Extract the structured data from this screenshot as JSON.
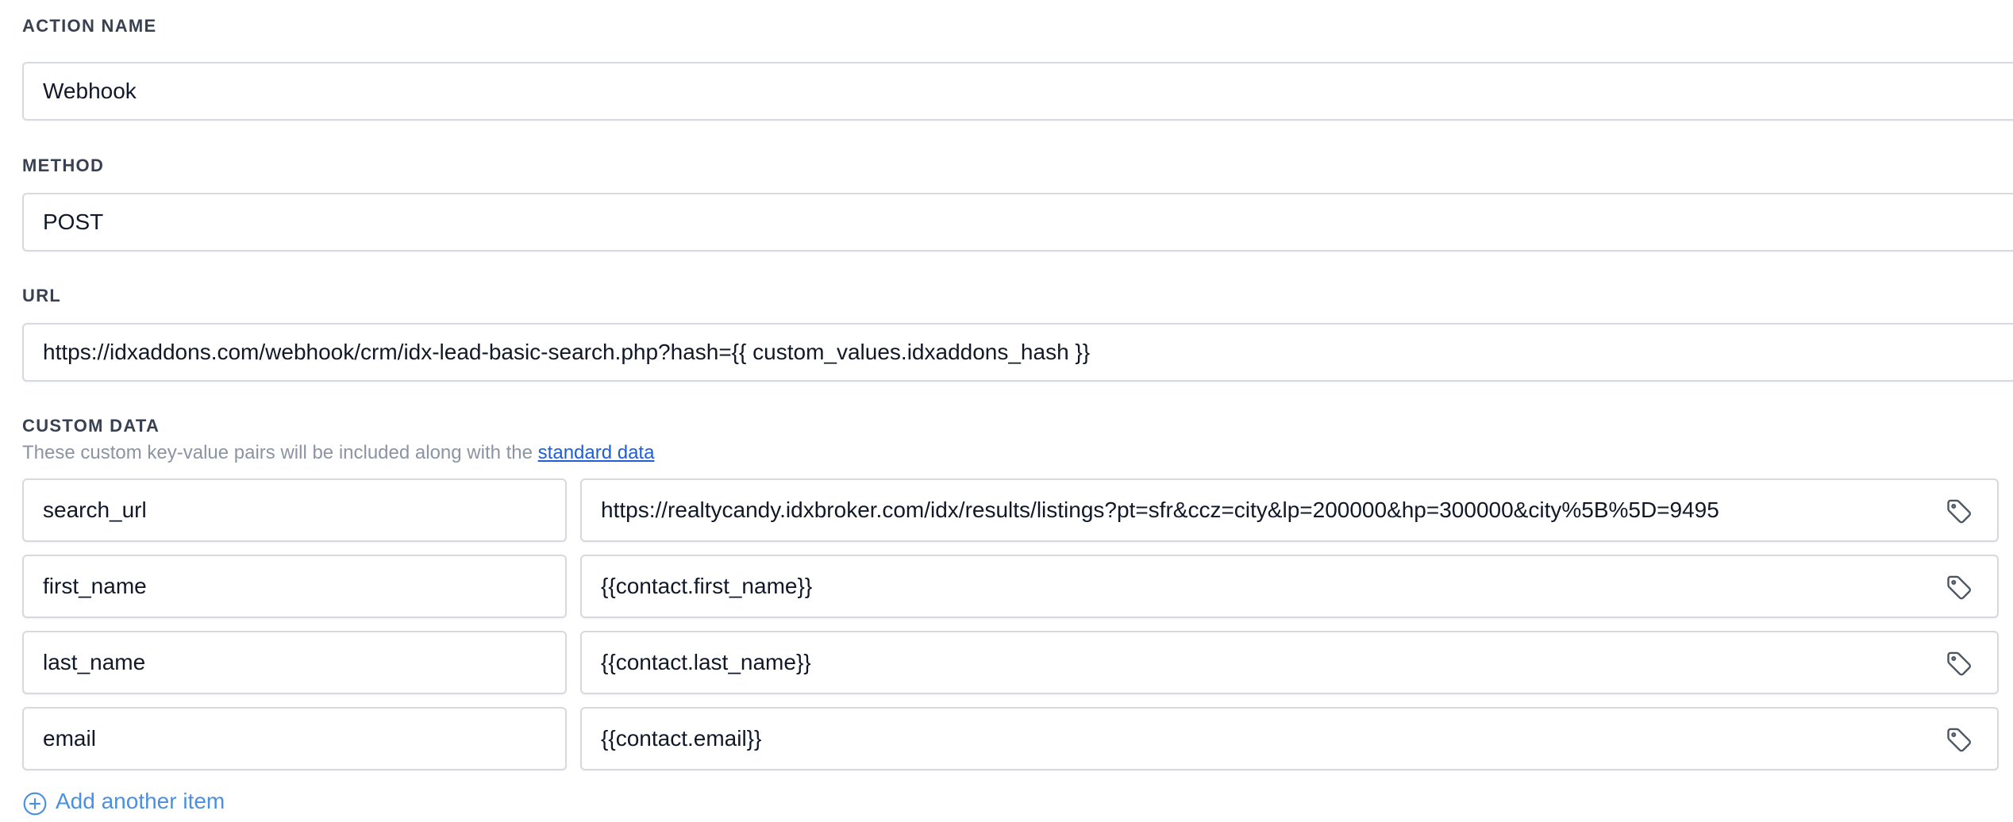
{
  "action_name": {
    "label": "ACTION NAME",
    "value": "Webhook"
  },
  "method": {
    "label": "METHOD",
    "value": "POST"
  },
  "url": {
    "label": "URL",
    "value": "https://idxaddons.com/webhook/crm/idx-lead-basic-search.php?hash={{ custom_values.idxaddons_hash }}"
  },
  "custom_data": {
    "label": "CUSTOM DATA",
    "helper_prefix": "These custom key-value pairs will be included along with the ",
    "helper_link": "standard data",
    "rows": [
      {
        "key": "search_url",
        "value": "https://realtycandy.idxbroker.com/idx/results/listings?pt=sfr&ccz=city&lp=200000&hp=300000&city%5B%5D=9495"
      },
      {
        "key": "first_name",
        "value": "{{contact.first_name}}"
      },
      {
        "key": "last_name",
        "value": "{{contact.last_name}}"
      },
      {
        "key": "email",
        "value": "{{contact.email}}"
      }
    ],
    "add_label": "Add another item"
  },
  "icons": {
    "tag": "tag-icon",
    "add": "plus-circle-icon"
  },
  "colors": {
    "label": "#374151",
    "link": "#1f5fd6",
    "add_link": "#4a90e2",
    "border": "#d6d9de"
  }
}
